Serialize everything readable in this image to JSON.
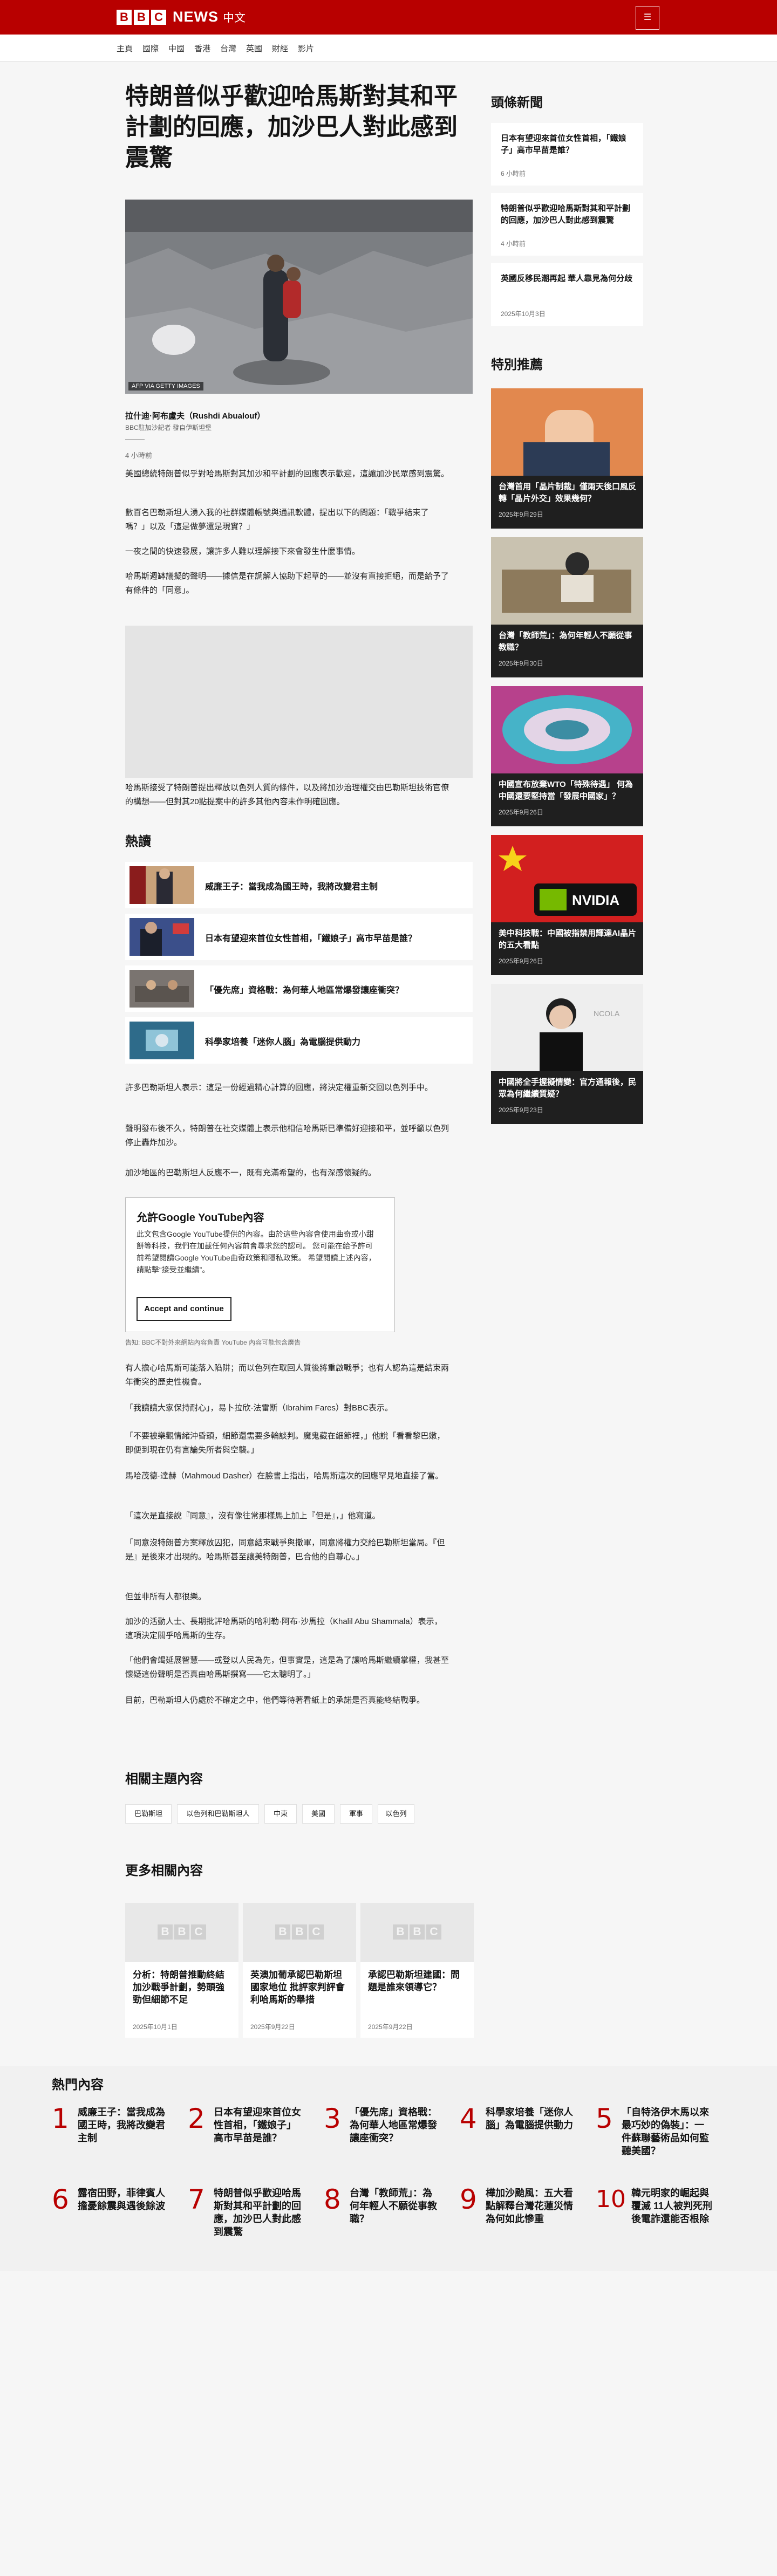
{
  "header": {
    "logo_letters": [
      "B",
      "B",
      "C"
    ],
    "logo_news": "NEWS",
    "logo_lang": "中文",
    "menu_label": "☰"
  },
  "nav": [
    "主頁",
    "國際",
    "中國",
    "香港",
    "台灣",
    "英國",
    "財經",
    "影片"
  ],
  "article": {
    "title": "特朗普似乎歡迎哈馬斯對其和平計劃的回應，加沙巴人對此感到震驚",
    "image_credit": "AFP VIA GETTY IMAGES",
    "author": "拉什迪·阿布盧夫（Rushdi Abualouf）",
    "author_role": "BBC駐加沙記者 發自伊斯坦堡",
    "time": "4 小時前",
    "paras": [
      "美國總統特朗普似乎對哈馬斯對其加沙和平計劃的回應表示歡迎，這讓加沙民眾感到震驚。",
      "數百名巴勒斯坦人湧入我的社群媒體帳號與通訊軟體，提出以下的問題：「戰爭結束了嗎？」以及「這是做夢還是現實？」",
      "一夜之間的快速發展，讓許多人難以理解接下來會發生什麼事情。",
      "哈馬斯週缽議擬的聲明——據信是在調解人協助下起草的——並沒有直接拒絕，而是給予了有條件的「同意」。",
      "哈馬斯接受了特朗普提出釋放以色列人質的條件，以及將加沙治理權交由巴勒斯坦技術官僚的構想——但對其20點提案中的許多其他內容未作明確回應。",
      "許多巴勒斯坦人表示：這是一份經過精心計算的回應，將決定權重新交回以色列手中。",
      "聲明發布後不久，特朗普在社交媒體上表示他相信哈馬斯已準備好迎接和平，並呼籲以色列停止轟炸加沙。",
      "加沙地區的巴勒斯坦人反應不一，既有充滿希望的，也有深感懷疑的。",
      "有人擔心哈馬斯可能落入陷阱；而以色列在取回人質後將重啟戰爭；也有人認為這是結束兩年衝突的歷史性機會。",
      "「我讀讀大家保持耐心」，易卜拉欣·法雷斯（Ibrahim Fares）對BBC表示。",
      "「不要被樂觀情緒沖昏頭，細節還需要多輪談判。魔鬼藏在細節裡，」他說「看看黎巴嫩，即便到現在仍有言論失所者與空襲。」",
      "馬哈茂德·達赫（Mahmoud Dasher）在臉書上指出，哈馬斯這次的回應罕見地直接了當。",
      "「這次是直接說『同意』，沒有像往常那樣馬上加上『但是』，」他寫道。",
      "「同意沒特朗普方案釋放囚犯，同意結束戰爭與撤軍，同意將權力交給巴勒斯坦當局。『但是』是後來才出現的。哈馬斯甚至讓美特朗普，巴合他的自尊心。」",
      "但並非所有人都很樂。",
      "加沙的活動人士、長期批評哈馬斯的哈利勒·阿布·沙馬拉（Khalil Abu Shammala）表示，這項決定關乎哈馬斯的生存。",
      "「他們會竭延展智慧——或登以人民為先，但事實是，這是為了讓哈馬斯繼續掌權，我甚至懷疑這份聲明是否真由哈馬斯撰寫——它太聰明了。」",
      "目前，巴勒斯坦人仍處於不確定之中，他們等待著看紙上的承諾是否真能終結戰爭。"
    ]
  },
  "popular": {
    "heading": "熱讀",
    "items": [
      "威廉王子：當我成為國王時，我將改變君主制",
      "日本有望迎來首位女性首相，「鐵娘子」高市早苗是誰？",
      "「優先席」資格戰：為何華人地區常爆發讓座衝突？",
      "科學家培養「迷你人腦」為電腦提供動力"
    ]
  },
  "consent": {
    "title": "允許Google YouTube內容",
    "body": "此文包含Google YouTube提供的內容。由於這些內容會使用曲奇或小甜餅等科技，我們在加載任何內容前會尋求您的認可。 您可能在給予許可前希望閱讀Google YouTube曲奇政策和隱私政策。 希望閱讀上述內容，請點擊“接受並繼續”。",
    "button": "Accept and continue",
    "note": "告知: BBC不對外來網站內容負責 YouTube 內容可能包含廣告"
  },
  "topics": {
    "heading": "相關主題內容",
    "tags": [
      "巴勒斯坦",
      "以色列和巴勒斯坦人",
      "中東",
      "美國",
      "軍事",
      "以色列"
    ]
  },
  "more": {
    "heading": "更多相關內容",
    "cards": [
      {
        "title": "分析：特朗普推動終結加沙戰爭計劃，勢頭強勁但細節不足",
        "date": "2025年10月1日"
      },
      {
        "title": "英澳加葡承認巴勒斯坦國家地位 批評家判評會利哈馬斯的舉措",
        "date": "2025年9月22日"
      },
      {
        "title": "承認巴勒斯坦建國：問題是誰來領導它？",
        "date": "2025年9月22日"
      }
    ]
  },
  "hot": {
    "heading": "熱門內容",
    "items": [
      {
        "n": "1",
        "t": "威廉王子：當我成為國王時，我將改變君主制"
      },
      {
        "n": "2",
        "t": "日本有望迎來首位女性首相，「鐵娘子」高市早苗是誰？"
      },
      {
        "n": "3",
        "t": "「優先席」資格戰：為何華人地區常爆發讓座衝突？"
      },
      {
        "n": "4",
        "t": "科學家培養「迷你人腦」為電腦提供動力"
      },
      {
        "n": "5",
        "t": "「自特洛伊木馬以來最巧妙的偽裝」：一件蘇聯藝術品如何監聽美國？"
      },
      {
        "n": "6",
        "t": "露宿田野，菲律賓人擔憂餘震與遇後餘波"
      },
      {
        "n": "7",
        "t": "特朗普似乎歡迎哈馬斯對其和平計劃的回應，加沙巴人對此感到震驚"
      },
      {
        "n": "8",
        "t": "台灣「教師荒」：為何年輕人不願從事教職？"
      },
      {
        "n": "9",
        "t": "樺加沙颱風：五大看點解釋台灣花蓮災情為何如此慘重"
      },
      {
        "n": "10",
        "t": "韓元明家的崛起與覆滅 11人被判死刑後電詐還能否根除"
      }
    ]
  },
  "side": {
    "latest_heading": "頭條新聞",
    "latest": [
      {
        "t": "日本有望迎來首位女性首相，「鐵娘子」高市早苗是誰？",
        "d": "6 小時前"
      },
      {
        "t": "特朗普似乎歡迎哈馬斯對其和平計劃的回應，加沙巴人對此感到震驚",
        "d": "4 小時前"
      },
      {
        "t": "英國反移民潮再起 華人靠見為何分歧",
        "d": "2025年10月3日"
      }
    ],
    "featured_heading": "特別推薦",
    "featured": [
      {
        "t": "台灣首用「晶片制裁」僅兩天後口風反轉「晶片外交」效果幾何？",
        "d": "2025年9月29日"
      },
      {
        "t": "台灣「教師荒」：為何年輕人不願從事教職？",
        "d": "2025年9月30日"
      },
      {
        "t": "中國宣布放棄WTO「特殊待遇」 何為中國還要堅持當「發展中國家」？",
        "d": "2025年9月26日"
      },
      {
        "t": "美中科技戰：中國被指禁用輝達AI晶片的五大看點",
        "d": "2025年9月26日"
      },
      {
        "t": "中國將全手握擬情變：官方通報後，民眾為何繼續質疑？",
        "d": "2025年9月23日"
      }
    ]
  }
}
